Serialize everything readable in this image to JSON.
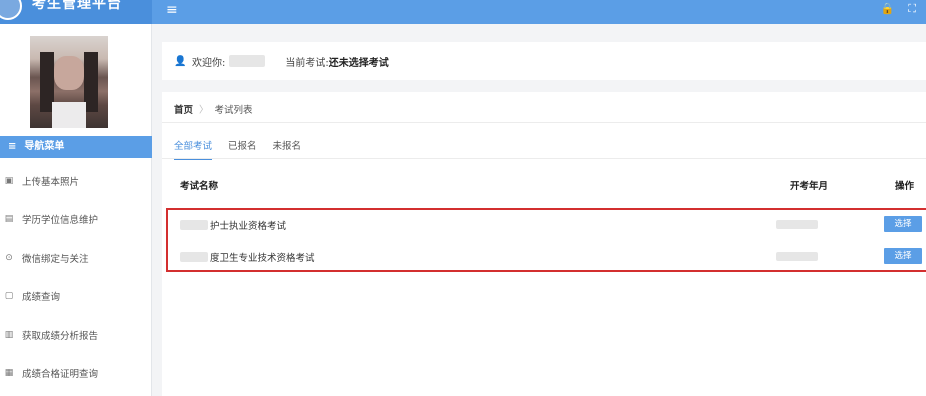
{
  "app": {
    "title": "考生管理平台"
  },
  "topbar": {
    "icons": [
      "lock-icon",
      "fullscreen-icon"
    ]
  },
  "sidebar": {
    "nav_header": "导航菜单",
    "items": [
      {
        "label": "上传基本照片",
        "icon": "image-icon"
      },
      {
        "label": "学历学位信息维护",
        "icon": "document-icon"
      },
      {
        "label": "微信绑定与关注",
        "icon": "wechat-icon"
      },
      {
        "label": "成绩查询",
        "icon": "file-icon"
      },
      {
        "label": "获取成绩分析报告",
        "icon": "report-icon"
      },
      {
        "label": "成绩合格证明查询",
        "icon": "certificate-icon"
      }
    ]
  },
  "welcome": {
    "greeting": "欢迎你:",
    "current_exam_label": "当前考试:",
    "current_exam_value": "还未选择考试"
  },
  "breadcrumb": {
    "home": "首页",
    "separator": "〉",
    "current": "考试列表"
  },
  "tabs": [
    {
      "label": "全部考试",
      "active": true
    },
    {
      "label": "已报名",
      "active": false
    },
    {
      "label": "未报名",
      "active": false
    }
  ],
  "table": {
    "headers": {
      "name": "考试名称",
      "date": "开考年月",
      "action": "操作"
    },
    "rows": [
      {
        "name": "护士执业资格考试",
        "action": "选择"
      },
      {
        "name": "度卫生专业技术资格考试",
        "action": "选择"
      }
    ]
  },
  "colors": {
    "primary": "#5b9ee6",
    "highlight_border": "#d32f2f"
  }
}
